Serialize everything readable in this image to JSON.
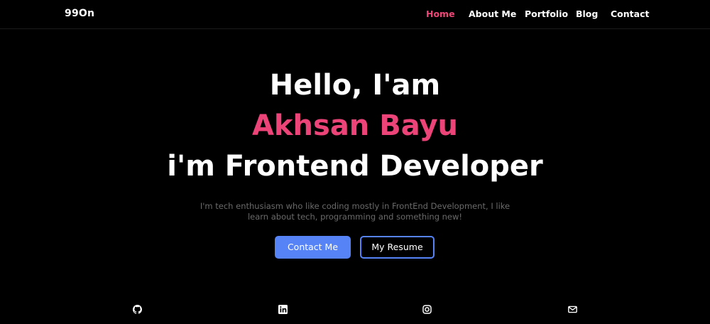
{
  "nav": {
    "brand": "99On",
    "items": [
      {
        "label": "Home",
        "active": true
      },
      {
        "label": "About Me",
        "active": false
      },
      {
        "label": "Portfolio",
        "active": false
      },
      {
        "label": "Blog",
        "active": false
      },
      {
        "label": "Contact",
        "active": false
      }
    ]
  },
  "hero": {
    "greeting": "Hello, I'am",
    "name": "Akhsan Bayu",
    "role": "i'm Frontend Developer",
    "tagline_line1": "I'm tech enthusiasm who like coding mostly in FrontEnd Development, I like",
    "tagline_line2": "learn about tech, programming and something new!"
  },
  "buttons": {
    "contact_label": "Contact Me",
    "resume_label": "My Resume"
  },
  "socials": [
    {
      "icon": "github-icon"
    },
    {
      "icon": "linkedin-icon"
    },
    {
      "icon": "instagram-icon"
    },
    {
      "icon": "mail-icon"
    }
  ],
  "colors": {
    "background": "#000000",
    "accent_pink": "#ec4479",
    "accent_blue": "#5683f5",
    "tagline_gray": "#6a6a6a"
  }
}
